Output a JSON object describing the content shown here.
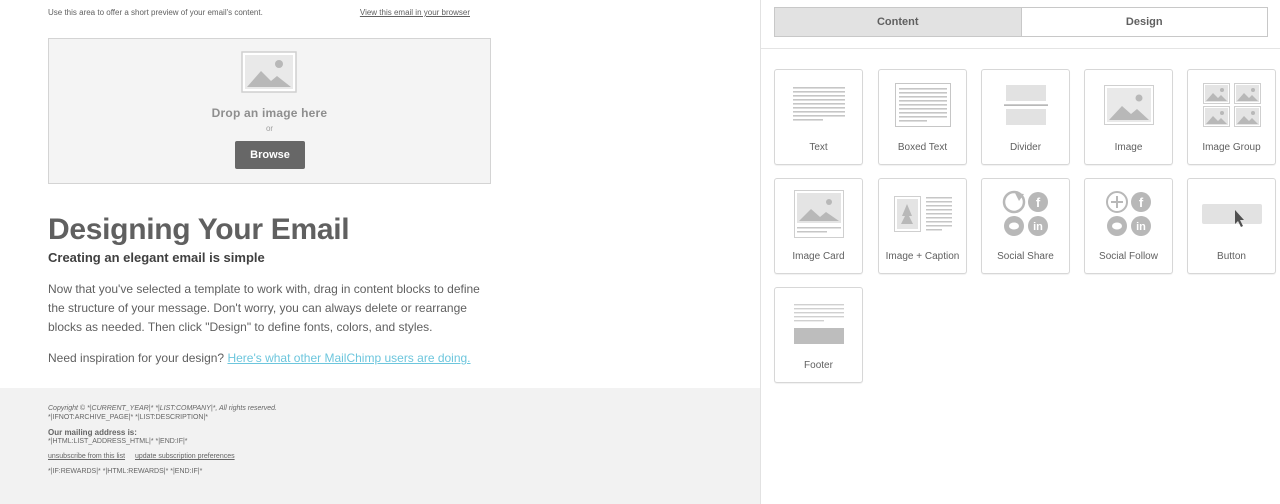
{
  "email": {
    "preheader_text": "Use this area to offer a short preview of your email's content.",
    "view_in_browser": "View this email in your browser",
    "dropzone": {
      "title": "Drop an image here",
      "or": "or",
      "browse": "Browse",
      "icon": "image-placeholder-icon"
    },
    "heading": "Designing Your Email",
    "subheading": "Creating an elegant email is simple",
    "paragraph": "Now that you've selected a template to work with, drag in content blocks to define the structure of your message. Don't worry, you can always delete or rearrange blocks as needed. Then click \"Design\" to define fonts, colors, and styles.",
    "inspiration_prefix": "Need inspiration for your design?",
    "inspiration_link": "Here's what other MailChimp users are doing.",
    "footer": {
      "copyright": "Copyright © *|CURRENT_YEAR|* *|LIST:COMPANY|*, All rights reserved.",
      "archive": "*|IFNOT:ARCHIVE_PAGE|* *|LIST:DESCRIPTION|*",
      "address_label": "Our mailing address is:",
      "address": "*|HTML:LIST_ADDRESS_HTML|* *|END:IF|*",
      "unsubscribe": "unsubscribe from this list",
      "update_prefs": "update subscription preferences",
      "rewards": "*|IF:REWARDS|* *|HTML:REWARDS|* *|END:IF|*"
    }
  },
  "panel": {
    "tabs": [
      {
        "label": "Content",
        "active": true
      },
      {
        "label": "Design",
        "active": false
      }
    ],
    "blocks": [
      {
        "label": "Text",
        "icon": "text-block-icon"
      },
      {
        "label": "Boxed Text",
        "icon": "boxed-text-icon"
      },
      {
        "label": "Divider",
        "icon": "divider-icon"
      },
      {
        "label": "Image",
        "icon": "image-icon"
      },
      {
        "label": "Image Group",
        "icon": "image-group-icon"
      },
      {
        "label": "Image Card",
        "icon": "image-card-icon"
      },
      {
        "label": "Image + Caption",
        "icon": "image-caption-icon"
      },
      {
        "label": "Social Share",
        "icon": "social-share-icon"
      },
      {
        "label": "Social Follow",
        "icon": "social-follow-icon"
      },
      {
        "label": "Button",
        "icon": "button-block-icon"
      },
      {
        "label": "Footer",
        "icon": "footer-block-icon"
      }
    ]
  },
  "colors": {
    "link": "#6dc6dd",
    "browse_button": "#676767",
    "active_tab": "#e2e2e2",
    "footer_bg": "#f2f2f2"
  }
}
